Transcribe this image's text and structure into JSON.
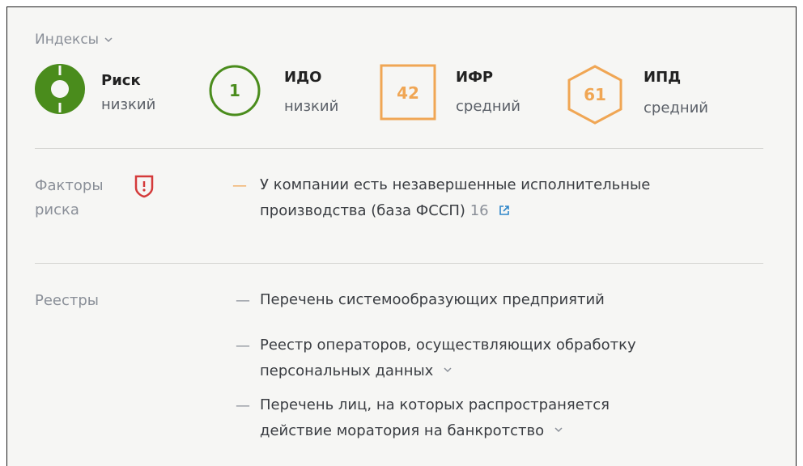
{
  "indexes": {
    "toggle_label": "Индексы",
    "items": [
      {
        "name": "Риск",
        "level": "низкий"
      },
      {
        "name": "ИДО",
        "value": "1",
        "level": "низкий"
      },
      {
        "name": "ИФР",
        "value": "42",
        "level": "средний"
      },
      {
        "name": "ИПД",
        "value": "61",
        "level": "средний"
      }
    ]
  },
  "risk_factors": {
    "label_line1": "Факторы",
    "label_line2": "риска",
    "items": [
      {
        "line1": "У компании есть незавершенные исполнительные",
        "line2": "производства (база ФССП)",
        "count": "16"
      }
    ]
  },
  "registries": {
    "label": "Реестры",
    "items": [
      {
        "line1": "Перечень системообразующих предприятий"
      },
      {
        "line1": "Реестр операторов, осуществляющих обработку",
        "line2": "персональных данных"
      },
      {
        "line1": "Перечень лиц, на которых распространяется",
        "line2": "действие моратория на банкротство"
      }
    ]
  },
  "colors": {
    "green": "#4a8c1c",
    "orange": "#f0a654",
    "red": "#d43a3a",
    "link_blue": "#2f86c9",
    "background": "#f6f6f4"
  }
}
